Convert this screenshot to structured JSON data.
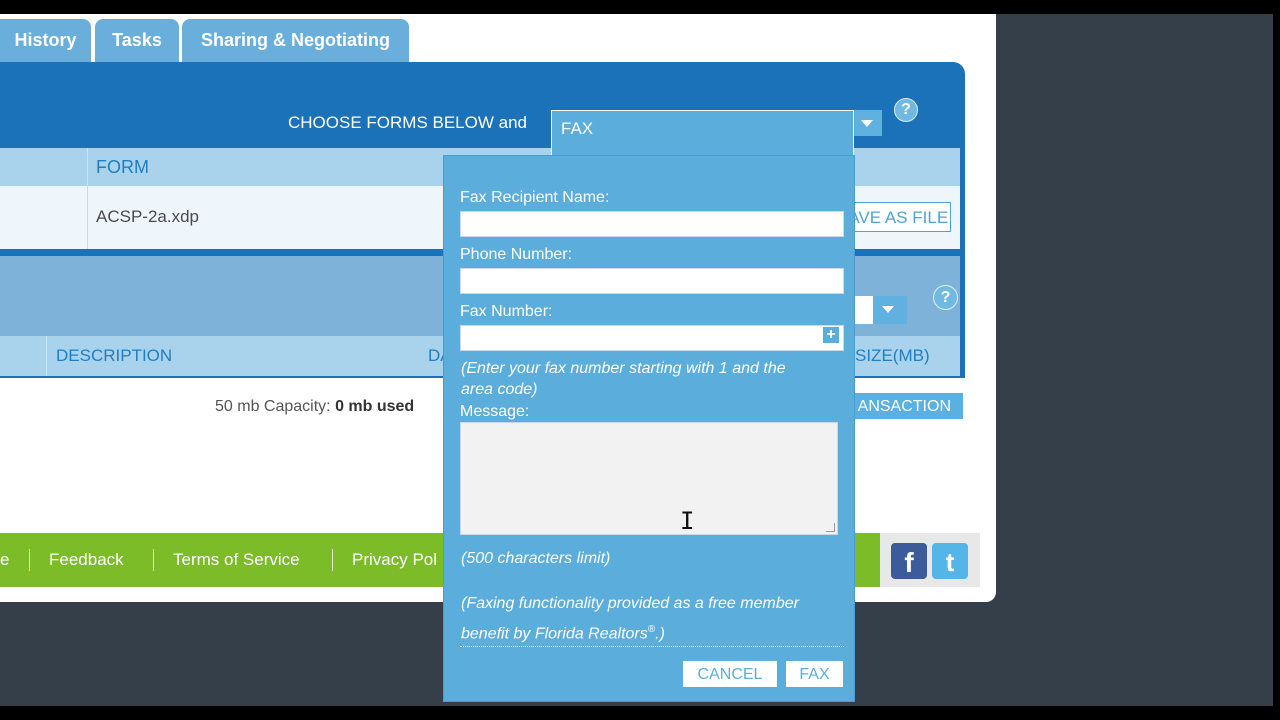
{
  "tabs": [
    {
      "label": "History"
    },
    {
      "label": "Tasks"
    },
    {
      "label": "Sharing & Negotiating"
    }
  ],
  "actions": {
    "choose_label": "CHOOSE FORMS BELOW and",
    "selected_action": "FAX",
    "help_icon": "?"
  },
  "forms_table": {
    "header": "FORM",
    "rows": [
      {
        "form": "ACSP-2a.xdp"
      }
    ],
    "save_button": "SAVE AS FILE"
  },
  "documents_table": {
    "headers": {
      "description": "DESCRIPTION",
      "date": "DA",
      "size": "SIZE(MB)"
    }
  },
  "capacity": {
    "prefix": "50 mb Capacity:",
    "used": "0 mb used"
  },
  "transaction_button": "ANSACTION",
  "footer": {
    "links": [
      "e",
      "Feedback",
      "Terms of Service",
      "Privacy Pol"
    ],
    "social": {
      "facebook": "f",
      "twitter": "t"
    }
  },
  "fax_dialog": {
    "recipient_label": "Fax Recipient Name:",
    "recipient_value": "",
    "phone_label": "Phone Number:",
    "phone_value": "",
    "fax_label": "Fax Number:",
    "fax_value": "",
    "fax_hint_line1": "(Enter your fax number starting with 1 and the",
    "fax_hint_line2": "area code)",
    "message_label": "Message:",
    "message_value": "",
    "char_limit": "(500 characters limit)",
    "benefit_line1": "(Faxing functionality provided as a free member",
    "benefit_line2": "benefit by Florida Realtors",
    "benefit_reg": "®",
    "benefit_end": ".)",
    "cancel_button": "CANCEL",
    "fax_button": "FAX"
  },
  "colors": {
    "primary_blue": "#1b72b8",
    "dialog_blue": "#5baedc",
    "footer_green": "#7cbc28"
  }
}
